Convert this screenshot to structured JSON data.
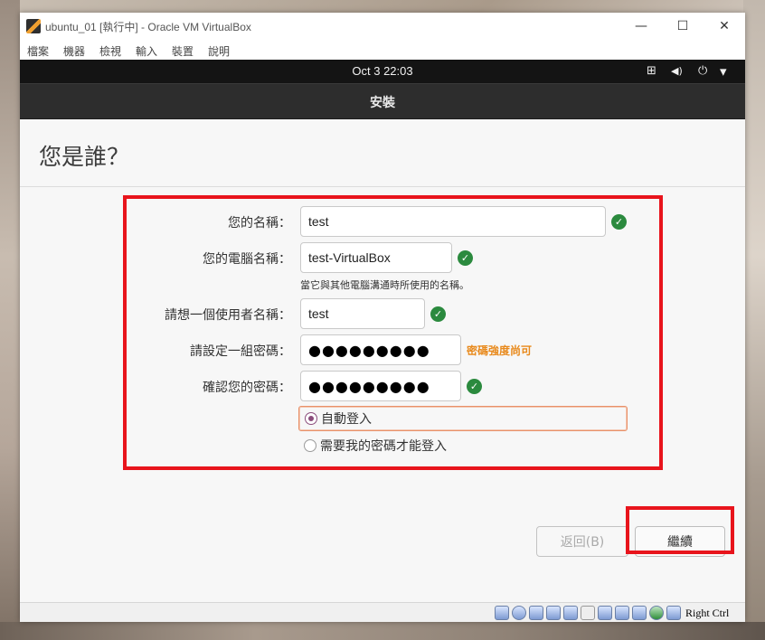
{
  "window": {
    "title": "ubuntu_01 [執行中] - Oracle VM VirtualBox",
    "minimize_glyph": "—",
    "maximize_glyph": "☐",
    "close_glyph": "✕"
  },
  "menubar": [
    "檔案",
    "機器",
    "檢視",
    "輸入",
    "裝置",
    "說明"
  ],
  "guest_topbar": {
    "clock": "Oct 3  22:03",
    "icons": [
      "network-icon",
      "volume-icon",
      "power-icon",
      "dropdown-arrow-icon"
    ],
    "network_glyph": "⊞",
    "volume_glyph": "◀)",
    "power_glyph": "⏻",
    "dropdown_glyph": "▾"
  },
  "installer": {
    "header_title": "安裝",
    "page_heading": "您是誰？",
    "fields": {
      "name": {
        "label": "您的名稱：",
        "value": "test",
        "valid": true
      },
      "computer": {
        "label": "您的電腦名稱：",
        "value": "test-VirtualBox",
        "valid": true,
        "hint": "當它與其他電腦溝通時所使用的名稱。"
      },
      "username": {
        "label": "請想一個使用者名稱：",
        "value": "test",
        "valid": true
      },
      "password": {
        "label": "請設定一組密碼：",
        "value": "●●●●●●●●●",
        "strength": "密碼強度尚可"
      },
      "confirm": {
        "label": "確認您的密碼：",
        "value": "●●●●●●●●●",
        "valid": true
      }
    },
    "check_glyph": "✓",
    "login_options": [
      {
        "label": "自動登入",
        "selected": true
      },
      {
        "label": "需要我的密碼才能登入",
        "selected": false
      }
    ],
    "buttons": {
      "back": "返回(B)",
      "continue": "繼續"
    },
    "progress": {
      "total_steps": 7
    }
  },
  "statusbar": {
    "icons": [
      "hard-disk-icon",
      "optical-drive-icon",
      "audio-icon",
      "network-adapter-icon",
      "usb-icon",
      "shared-folder-icon",
      "display-icon",
      "recording-icon",
      "cpu-icon",
      "mouse-integration-icon",
      "keyboard-icon"
    ],
    "host_key": "Right Ctrl"
  },
  "colors": {
    "accent_purple": "#8c4a86",
    "valid_green": "#2b8a3e",
    "strength_orange": "#e8891b",
    "highlight_red": "#e8141c"
  }
}
